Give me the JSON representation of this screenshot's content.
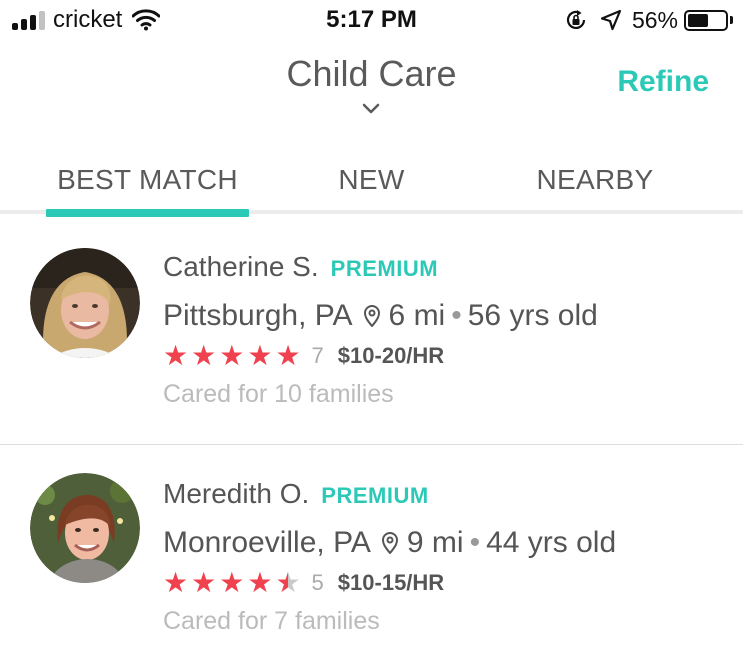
{
  "status_bar": {
    "carrier": "cricket",
    "time": "5:17 PM",
    "battery_percent": "56%",
    "battery_level": 0.56,
    "icons": [
      "signal-icon",
      "wifi-icon",
      "rotation-lock-icon",
      "location-arrow-icon",
      "battery-icon"
    ]
  },
  "header": {
    "title": "Child Care",
    "refine_label": "Refine",
    "chevron_icon": "chevron-down-icon"
  },
  "tabs": [
    {
      "label": "BEST MATCH",
      "active": true
    },
    {
      "label": "NEW",
      "active": false
    },
    {
      "label": "NEARBY",
      "active": false
    }
  ],
  "caregivers": [
    {
      "name": "Catherine S.",
      "badge": "PREMIUM",
      "city": "Pittsburgh, PA",
      "distance": "6 mi",
      "age": "56 yrs old",
      "rating": 5,
      "review_count": "7",
      "rate": "$10-20/HR",
      "cared_for": "Cared for 10 families"
    },
    {
      "name": "Meredith O.",
      "badge": "PREMIUM",
      "city": "Monroeville, PA",
      "distance": "9 mi",
      "age": "44 yrs old",
      "rating": 4.5,
      "review_count": "5",
      "rate": "$10-15/HR",
      "cared_for": "Cared for 7 families"
    }
  ],
  "colors": {
    "accent": "#2cc9b7",
    "star": "#f0414e",
    "star_empty": "#c9c9c9",
    "text": "#555555",
    "muted": "#bbbbbb"
  }
}
